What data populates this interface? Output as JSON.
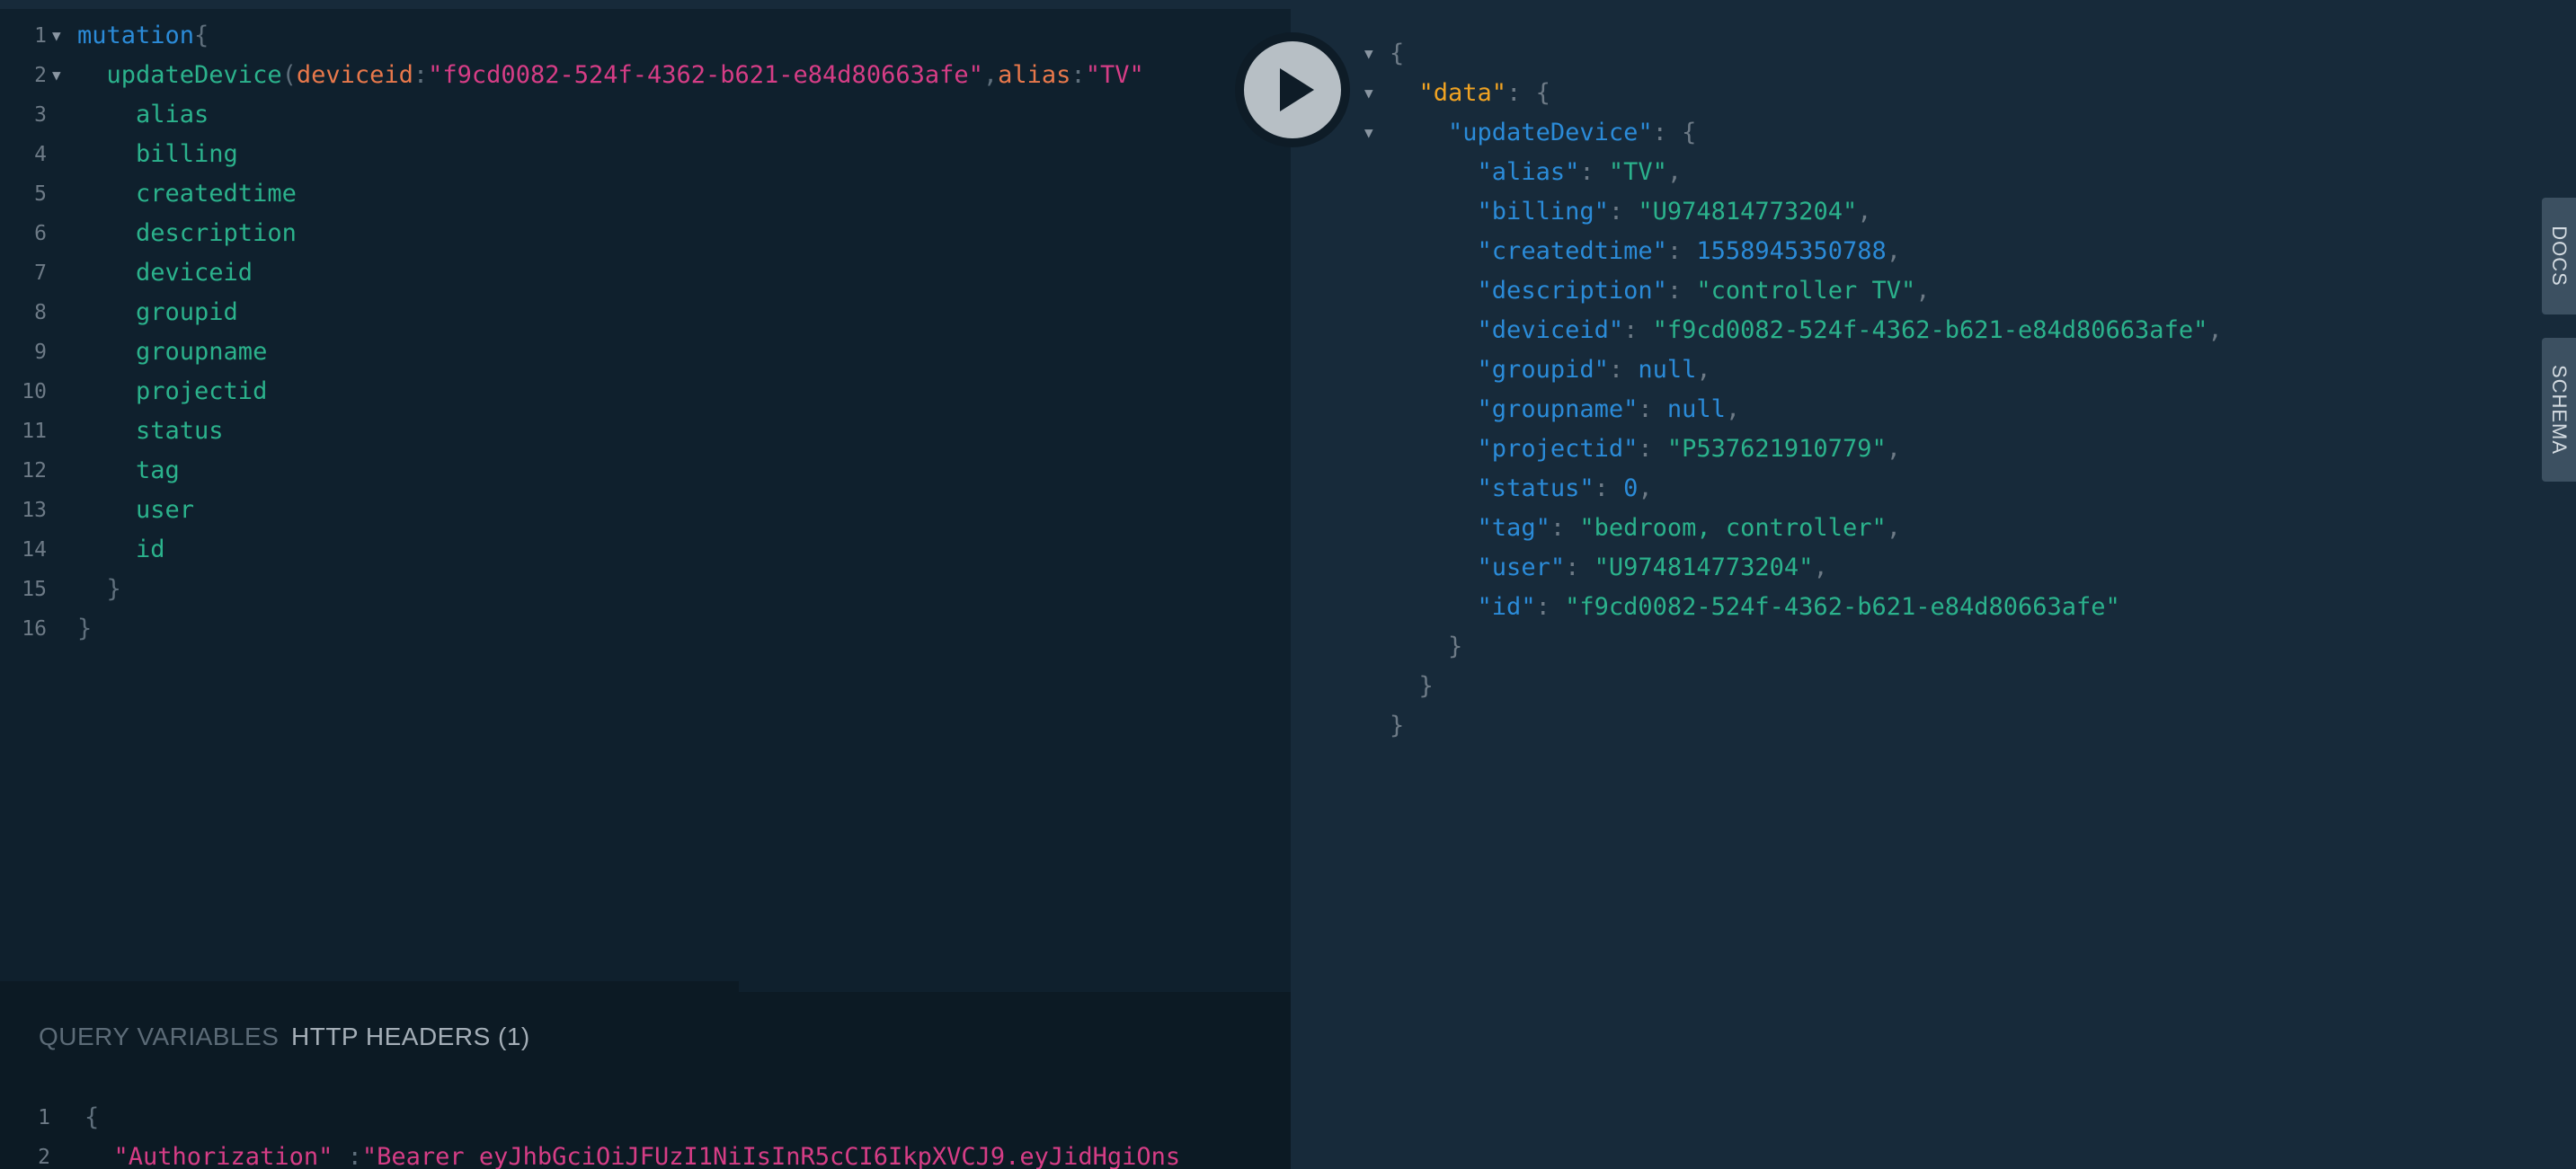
{
  "query_lines": [
    {
      "n": "1",
      "parts": [
        [
          "mutation",
          "kw"
        ],
        [
          "{",
          "punc"
        ]
      ]
    },
    {
      "n": "2",
      "parts": [
        [
          "  updateDevice",
          "fn"
        ],
        [
          "(",
          "punc"
        ],
        [
          "deviceid",
          "arg"
        ],
        [
          ":",
          "punc"
        ],
        [
          "\"f9cd0082-524f-4362-b621-e84d80663afe\"",
          "str"
        ],
        [
          ",",
          "punc"
        ],
        [
          "alias",
          "arg"
        ],
        [
          ":",
          "punc"
        ],
        [
          "\"TV\"",
          "str"
        ]
      ]
    },
    {
      "n": "3",
      "parts": [
        [
          "    alias",
          "field"
        ]
      ]
    },
    {
      "n": "4",
      "parts": [
        [
          "    billing",
          "field"
        ]
      ]
    },
    {
      "n": "5",
      "parts": [
        [
          "    createdtime",
          "field"
        ]
      ]
    },
    {
      "n": "6",
      "parts": [
        [
          "    description",
          "field"
        ]
      ]
    },
    {
      "n": "7",
      "parts": [
        [
          "    deviceid",
          "field"
        ]
      ]
    },
    {
      "n": "8",
      "parts": [
        [
          "    groupid",
          "field"
        ]
      ]
    },
    {
      "n": "9",
      "parts": [
        [
          "    groupname",
          "field"
        ]
      ]
    },
    {
      "n": "10",
      "parts": [
        [
          "    projectid",
          "field"
        ]
      ]
    },
    {
      "n": "11",
      "parts": [
        [
          "    status",
          "field"
        ]
      ]
    },
    {
      "n": "12",
      "parts": [
        [
          "    tag",
          "field"
        ]
      ]
    },
    {
      "n": "13",
      "parts": [
        [
          "    user",
          "field"
        ]
      ]
    },
    {
      "n": "14",
      "parts": [
        [
          "    id",
          "field"
        ]
      ]
    },
    {
      "n": "15",
      "parts": [
        [
          "  }",
          "punc"
        ]
      ]
    },
    {
      "n": "16",
      "parts": [
        [
          "}",
          "punc"
        ]
      ]
    }
  ],
  "result_lines": [
    {
      "parts": [
        [
          "{",
          "rpunc"
        ]
      ]
    },
    {
      "parts": [
        [
          "  ",
          "rpunc"
        ],
        [
          "\"data\"",
          "rdata"
        ],
        [
          ": {",
          "rpunc"
        ]
      ]
    },
    {
      "parts": [
        [
          "    ",
          "rpunc"
        ],
        [
          "\"updateDevice\"",
          "rkey"
        ],
        [
          ": {",
          "rpunc"
        ]
      ]
    },
    {
      "parts": [
        [
          "      ",
          "rpunc"
        ],
        [
          "\"alias\"",
          "rkey"
        ],
        [
          ": ",
          "rpunc"
        ],
        [
          "\"TV\"",
          "rstr"
        ],
        [
          ",",
          "rpunc"
        ]
      ]
    },
    {
      "parts": [
        [
          "      ",
          "rpunc"
        ],
        [
          "\"billing\"",
          "rkey"
        ],
        [
          ": ",
          "rpunc"
        ],
        [
          "\"U974814773204\"",
          "rstr"
        ],
        [
          ",",
          "rpunc"
        ]
      ]
    },
    {
      "parts": [
        [
          "      ",
          "rpunc"
        ],
        [
          "\"createdtime\"",
          "rkey"
        ],
        [
          ": ",
          "rpunc"
        ],
        [
          "1558945350788",
          "rnum"
        ],
        [
          ",",
          "rpunc"
        ]
      ]
    },
    {
      "parts": [
        [
          "      ",
          "rpunc"
        ],
        [
          "\"description\"",
          "rkey"
        ],
        [
          ": ",
          "rpunc"
        ],
        [
          "\"controller TV\"",
          "rstr"
        ],
        [
          ",",
          "rpunc"
        ]
      ]
    },
    {
      "parts": [
        [
          "      ",
          "rpunc"
        ],
        [
          "\"deviceid\"",
          "rkey"
        ],
        [
          ": ",
          "rpunc"
        ],
        [
          "\"f9cd0082-524f-4362-b621-e84d80663afe\"",
          "rstr"
        ],
        [
          ",",
          "rpunc"
        ]
      ]
    },
    {
      "parts": [
        [
          "      ",
          "rpunc"
        ],
        [
          "\"groupid\"",
          "rkey"
        ],
        [
          ": ",
          "rpunc"
        ],
        [
          "null",
          "rnum"
        ],
        [
          ",",
          "rpunc"
        ]
      ]
    },
    {
      "parts": [
        [
          "      ",
          "rpunc"
        ],
        [
          "\"groupname\"",
          "rkey"
        ],
        [
          ": ",
          "rpunc"
        ],
        [
          "null",
          "rnum"
        ],
        [
          ",",
          "rpunc"
        ]
      ]
    },
    {
      "parts": [
        [
          "      ",
          "rpunc"
        ],
        [
          "\"projectid\"",
          "rkey"
        ],
        [
          ": ",
          "rpunc"
        ],
        [
          "\"P537621910779\"",
          "rstr"
        ],
        [
          ",",
          "rpunc"
        ]
      ]
    },
    {
      "parts": [
        [
          "      ",
          "rpunc"
        ],
        [
          "\"status\"",
          "rkey"
        ],
        [
          ": ",
          "rpunc"
        ],
        [
          "0",
          "rnum"
        ],
        [
          ",",
          "rpunc"
        ]
      ]
    },
    {
      "parts": [
        [
          "      ",
          "rpunc"
        ],
        [
          "\"tag\"",
          "rkey"
        ],
        [
          ": ",
          "rpunc"
        ],
        [
          "\"bedroom, controller\"",
          "rstr"
        ],
        [
          ",",
          "rpunc"
        ]
      ]
    },
    {
      "parts": [
        [
          "      ",
          "rpunc"
        ],
        [
          "\"user\"",
          "rkey"
        ],
        [
          ": ",
          "rpunc"
        ],
        [
          "\"U974814773204\"",
          "rstr"
        ],
        [
          ",",
          "rpunc"
        ]
      ]
    },
    {
      "parts": [
        [
          "      ",
          "rpunc"
        ],
        [
          "\"id\"",
          "rkey"
        ],
        [
          ": ",
          "rpunc"
        ],
        [
          "\"f9cd0082-524f-4362-b621-e84d80663afe\"",
          "rstr"
        ]
      ]
    },
    {
      "parts": [
        [
          "    }",
          "rpunc"
        ]
      ]
    },
    {
      "parts": [
        [
          "  }",
          "rpunc"
        ]
      ]
    },
    {
      "parts": [
        [
          "}",
          "rpunc"
        ]
      ]
    }
  ],
  "bottom_tabs": {
    "query_variables": "QUERY VARIABLES",
    "http_headers": "HTTP HEADERS (1)"
  },
  "header_lines": [
    {
      "n": "1",
      "parts": [
        [
          "{",
          "punc"
        ]
      ]
    },
    {
      "n": "2",
      "parts": [
        [
          "  \"Authorization\"",
          "str"
        ],
        [
          " :",
          "punc"
        ],
        [
          "\"Bearer eyJhbGciOiJFUzI1NiIsInR5cCI6IkpXVCJ9.eyJidHgiOns",
          "str"
        ]
      ]
    }
  ],
  "side_tabs": {
    "docs": "DOCS",
    "schema": "SCHEMA"
  },
  "icons": {
    "run": "play-icon",
    "fold": "chevron-down-icon"
  },
  "colors": {
    "keyword": "#2b8bd8",
    "field": "#2bb28c",
    "argument": "#e8784b",
    "string": "#d63d86",
    "data_key": "#f1a322"
  }
}
